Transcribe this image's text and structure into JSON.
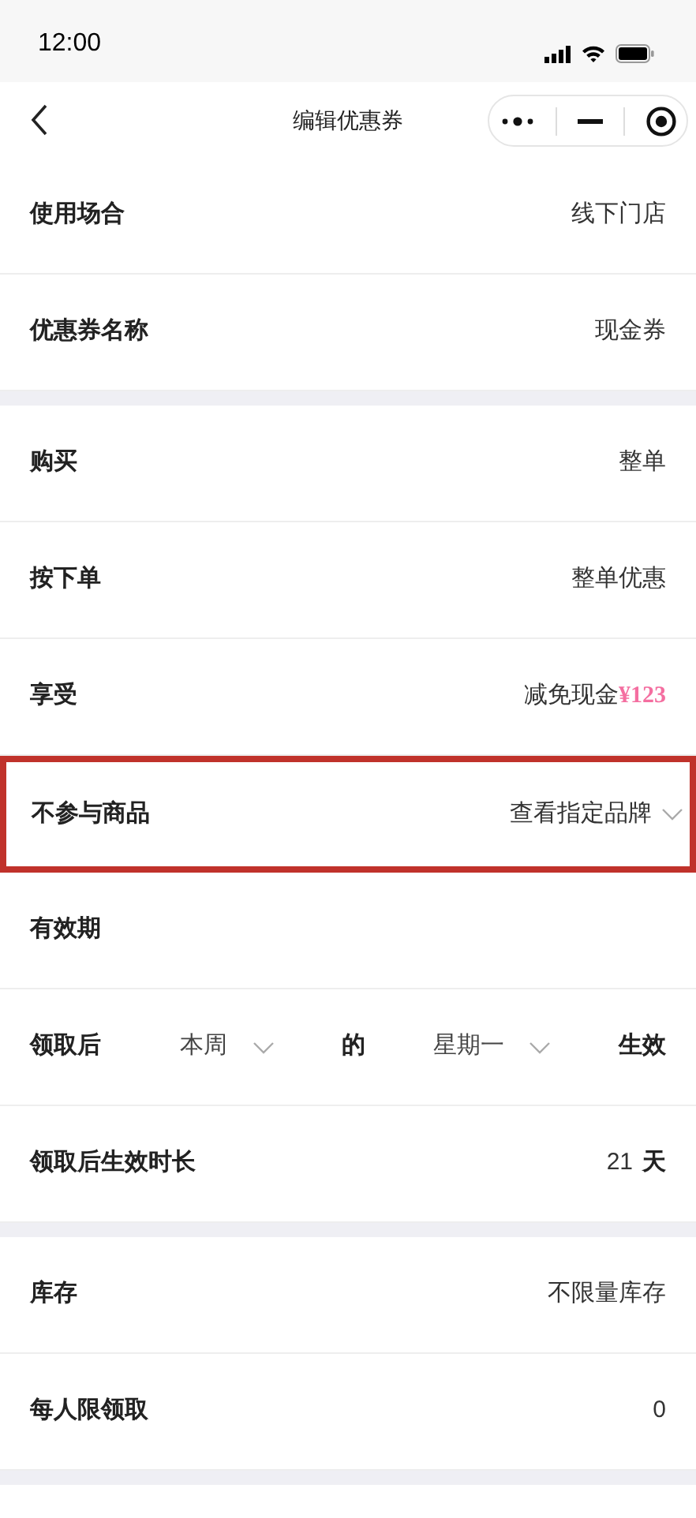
{
  "status_bar": {
    "time": "12:00"
  },
  "nav": {
    "title": "编辑优惠券"
  },
  "sections": [
    {
      "rows": [
        {
          "kind": "text",
          "label": "使用场合",
          "value": "线下门店",
          "highlighted": false
        },
        {
          "kind": "text",
          "label": "优惠券名称",
          "value": "现金券",
          "highlighted": false
        }
      ]
    },
    {
      "rows": [
        {
          "kind": "text",
          "label": "购买",
          "value": "整单",
          "highlighted": false
        },
        {
          "kind": "text",
          "label": "按下单",
          "value": "整单优惠",
          "highlighted": false
        },
        {
          "kind": "price",
          "label": "享受",
          "value": "减免现金",
          "price": "¥123",
          "highlighted": false
        },
        {
          "kind": "dropdown",
          "label": "不参与商品",
          "value": "查看指定品牌",
          "highlighted": true
        },
        {
          "kind": "title",
          "label": "有效期",
          "highlighted": false
        },
        {
          "kind": "schedule",
          "label": "领取后",
          "parts": [
            {
              "kind": "select",
              "text": "本周"
            },
            {
              "kind": "word",
              "text": "的"
            },
            {
              "kind": "select",
              "text": "星期一"
            },
            {
              "kind": "word",
              "text": "生效"
            }
          ],
          "highlighted": false
        },
        {
          "kind": "unit",
          "label": "领取后生效时长",
          "value": "21",
          "unit": "天",
          "highlighted": false
        }
      ]
    },
    {
      "rows": [
        {
          "kind": "text",
          "label": "库存",
          "value": "不限量库存",
          "highlighted": false
        },
        {
          "kind": "text",
          "label": "每人限领取",
          "value": "0",
          "highlighted": false
        }
      ]
    }
  ]
}
